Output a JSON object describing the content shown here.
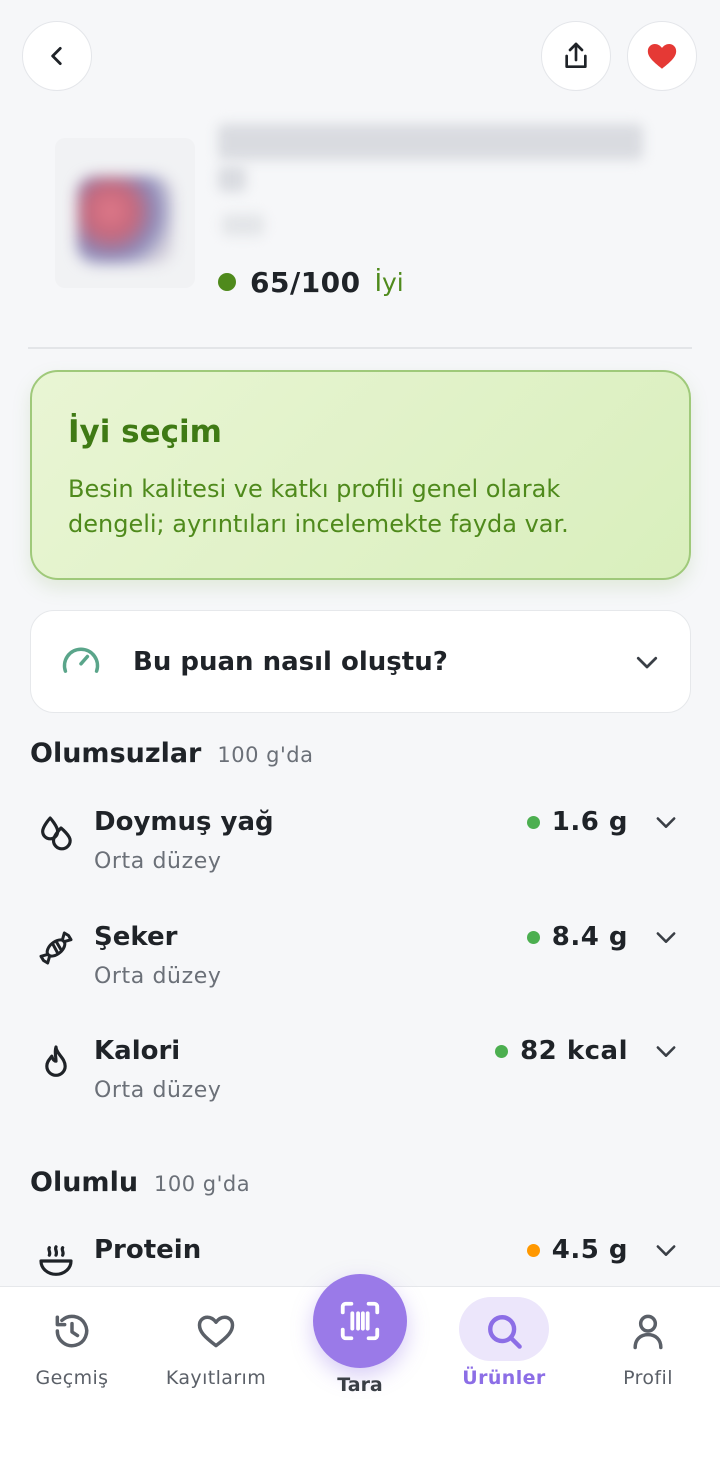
{
  "header": {
    "back_icon": "chevron-left-icon",
    "share_icon": "share-icon",
    "favorite_icon": "heart-filled-icon",
    "favorite_color": "#e53935"
  },
  "product": {
    "score": "65/100",
    "score_label": "İyi",
    "score_color": "#4f8a1c"
  },
  "verdict": {
    "title": "İyi seçim",
    "body_line1": "Besin kalitesi ve katkı profili genel olarak",
    "body_line2": "dengeli; ayrıntıları incelemekte fayda var."
  },
  "score_explainer": {
    "label": "Bu puan nasıl oluştu?",
    "icon": "gauge-icon"
  },
  "negatives": {
    "title": "Olumsuzlar",
    "per": "100 g'da",
    "items": [
      {
        "name": "Doymuş yağ",
        "level": "Orta düzey",
        "value": "1.6 g",
        "dot_color": "#4caf50",
        "icon": "drops-icon"
      },
      {
        "name": "Şeker",
        "level": "Orta düzey",
        "value": "8.4 g",
        "dot_color": "#4caf50",
        "icon": "candy-icon"
      },
      {
        "name": "Kalori",
        "level": "Orta düzey",
        "value": "82 kcal",
        "dot_color": "#4caf50",
        "icon": "flame-icon"
      }
    ]
  },
  "positives": {
    "title": "Olumlu",
    "per": "100 g'da",
    "items": [
      {
        "name": "Protein",
        "value": "4.5 g",
        "dot_color": "#ff9800",
        "icon": "bowl-icon"
      }
    ]
  },
  "nav": {
    "history": "Geçmiş",
    "saved": "Kayıtlarım",
    "scan": "Tara",
    "products": "Ürünler",
    "profile": "Profil",
    "active": "products",
    "accent": "#8c6ee6"
  }
}
